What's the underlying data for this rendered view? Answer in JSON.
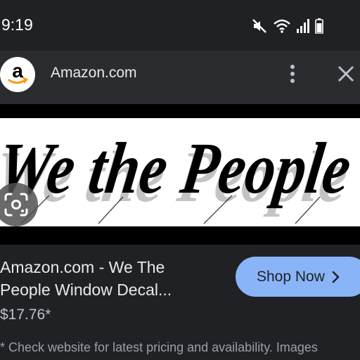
{
  "status_bar": {
    "time": "9:19",
    "icons": [
      "mute-icon",
      "wifi-icon",
      "signal-icon",
      "battery-icon"
    ]
  },
  "header": {
    "site_name": "Amazon.com",
    "logo_icon": "amazon-logo-icon",
    "logo_letter": "a",
    "more_icon": "more-vert-icon",
    "close_icon": "close-icon"
  },
  "hero": {
    "image_text": "We the People",
    "lens_icon": "google-lens-icon"
  },
  "product": {
    "title_line1": "Amazon.com - We The",
    "title_line2": "People Window Decal...",
    "price": "$17.76*",
    "shop_button_label": "Shop Now",
    "shop_button_icon": "chevron-right-icon"
  },
  "disclaimer": {
    "text": "* Check website for latest pricing and availability. Images"
  },
  "colors": {
    "background": "#202124",
    "header_bg": "#2b2c30",
    "accent": "#8ab4f8",
    "amazon_orange": "#ff9900"
  }
}
